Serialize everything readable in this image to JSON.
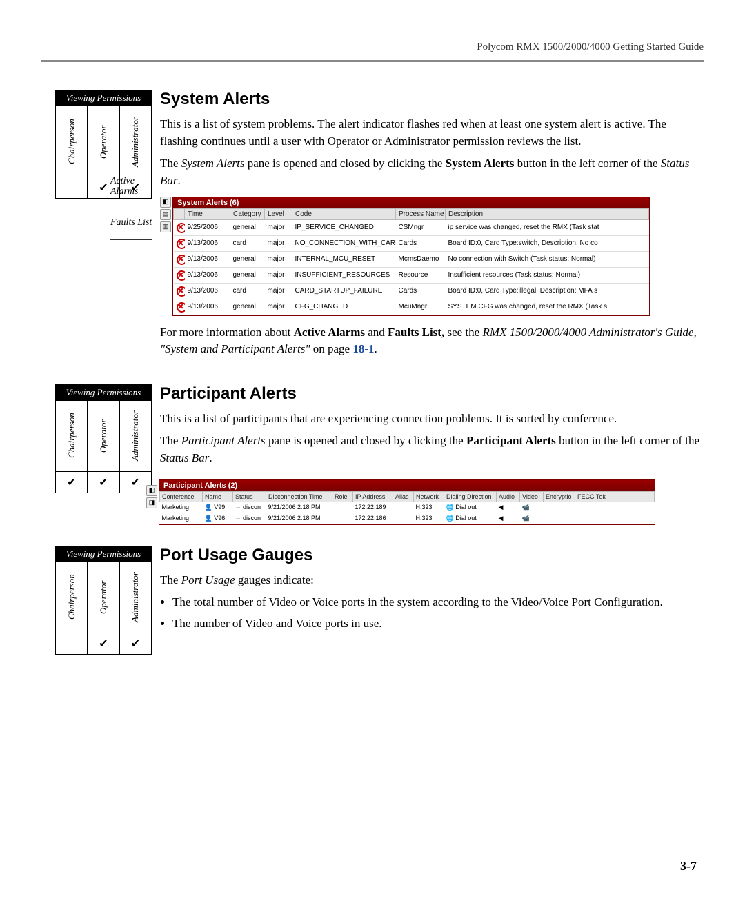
{
  "header": {
    "guide_title": "Polycom RMX 1500/2000/4000 Getting Started Guide"
  },
  "vp": {
    "title": "Viewing Permissions",
    "roles": [
      "Chairperson",
      "Operator",
      "Administrator"
    ],
    "check": "✔"
  },
  "sections": {
    "system_alerts": {
      "heading": "System Alerts",
      "p1": "This is a list of system problems. The alert indicator flashes red when at least one system alert is active. The flashing continues until a user with Operator or Administrator permission reviews the list.",
      "p2_a": "The ",
      "p2_b": "System Alerts",
      "p2_c": " pane is opened and closed by clicking the ",
      "p2_d": "System Alerts",
      "p2_e": " button in the left corner of the ",
      "p2_f": "Status Bar",
      "p2_g": ".",
      "fig_label1": "Active Alarms",
      "fig_label2": "Faults List",
      "ref_a": "For more information about ",
      "ref_b": "Active Alarms",
      "ref_c": " and ",
      "ref_d": "Faults List,",
      "ref_e": " see the ",
      "ref_f": "RMX 1500/2000/4000 Administrator's Guide, \"System and Participant Alerts\"",
      "ref_g": " on page ",
      "ref_page": "18-1",
      "ref_h": "."
    },
    "participant_alerts": {
      "heading": "Participant Alerts",
      "p1": "This is a list of participants that are experiencing connection problems. It is sorted by conference.",
      "p2_a": "The ",
      "p2_b": "Participant Alerts",
      "p2_c": " pane is opened and closed by clicking the ",
      "p2_d": "Participant Alerts",
      "p2_e": " button in the left corner of the ",
      "p2_f": "Status Bar",
      "p2_g": "."
    },
    "port_usage": {
      "heading": "Port Usage Gauges",
      "p1_a": "The ",
      "p1_b": "Port Usage",
      "p1_c": " gauges indicate:",
      "b1_a": "The total number of ",
      "b1_b": "Video",
      "b1_c": " or ",
      "b1_d": "Voice",
      "b1_e": " ports in the system according to the ",
      "b1_f": "Video/Voice Port Configuration",
      "b1_g": ".",
      "b2_a": "The number of ",
      "b2_b": "Video",
      "b2_c": " and ",
      "b2_d": "Voice",
      "b2_e": " ports in use."
    }
  },
  "sys_pane": {
    "title": "System Alerts (6)",
    "columns": [
      "Time",
      "Category",
      "Level",
      "Code",
      "Process Name",
      "Description"
    ],
    "rows": [
      {
        "time": "9/25/2006",
        "category": "general",
        "level": "major",
        "code": "IP_SERVICE_CHANGED",
        "process": "CSMngr",
        "desc": "ip service was changed, reset the RMX (Task stat"
      },
      {
        "time": "9/13/2006",
        "category": "card",
        "level": "major",
        "code": "NO_CONNECTION_WITH_CARD",
        "process": "Cards",
        "desc": "Board ID:0, Card Type:switch, Description: No co"
      },
      {
        "time": "9/13/2006",
        "category": "general",
        "level": "major",
        "code": "INTERNAL_MCU_RESET",
        "process": "McmsDaemo",
        "desc": "No connection with Switch (Task status: Normal)"
      },
      {
        "time": "9/13/2006",
        "category": "general",
        "level": "major",
        "code": "INSUFFICIENT_RESOURCES",
        "process": "Resource",
        "desc": "Insufficient resources (Task status: Normal)"
      },
      {
        "time": "9/13/2006",
        "category": "card",
        "level": "major",
        "code": "CARD_STARTUP_FAILURE",
        "process": "Cards",
        "desc": "Board ID:0, Card Type:illegal, Description: MFA s"
      },
      {
        "time": "9/13/2006",
        "category": "general",
        "level": "major",
        "code": "CFG_CHANGED",
        "process": "McuMngr",
        "desc": "SYSTEM.CFG was changed, reset the RMX (Task s"
      }
    ]
  },
  "part_pane": {
    "title": "Participant Alerts (2)",
    "columns": [
      "Conference",
      "Name",
      "Status",
      "Disconnection Time",
      "Role",
      "IP Address",
      "Alias",
      "Network",
      "Dialing Direction",
      "Audio",
      "Video",
      "Encryptio",
      "FECC Tok"
    ],
    "rows": [
      {
        "conference": "Marketing",
        "name": "V99",
        "status": "discon",
        "dtime": "9/21/2006 2:18 PM",
        "role": "",
        "ip": "172.22.189",
        "alias": "",
        "network": "H.323",
        "dial": "Dial out",
        "audio": "◀",
        "video": "📹",
        "enc": "",
        "fecc": ""
      },
      {
        "conference": "Marketing",
        "name": "V96",
        "status": "discon",
        "dtime": "9/21/2006 2:18 PM",
        "role": "",
        "ip": "172.22.186",
        "alias": "",
        "network": "H.323",
        "dial": "Dial out",
        "audio": "◀",
        "video": "📹",
        "enc": "",
        "fecc": ""
      }
    ]
  },
  "footer": {
    "page": "3-7"
  }
}
